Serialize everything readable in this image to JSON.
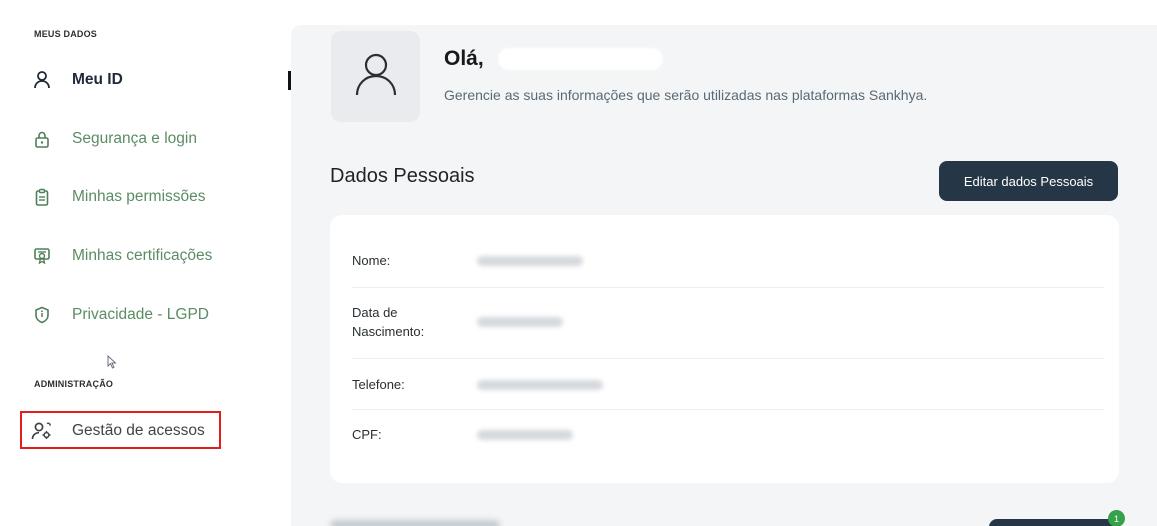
{
  "sidebar": {
    "section_my_data": "MEUS DADOS",
    "items": [
      {
        "label": "Meu ID",
        "icon": "user-icon"
      },
      {
        "label": "Segurança e login",
        "icon": "lock-icon"
      },
      {
        "label": "Minhas permissões",
        "icon": "clipboard-icon"
      },
      {
        "label": "Minhas certificações",
        "icon": "certificate-icon"
      },
      {
        "label": "Privacidade - LGPD",
        "icon": "shield-icon"
      }
    ],
    "section_admin": "ADMINISTRAÇÃO",
    "admin_items": [
      {
        "label": "Gestão de acessos",
        "icon": "user-settings-icon"
      }
    ]
  },
  "header": {
    "greeting": "Olá,",
    "subtitle": "Gerencie as suas informações que serão utilizadas nas plataformas Sankhya."
  },
  "personal_data": {
    "title": "Dados Pessoais",
    "edit_button": "Editar dados Pessoais",
    "fields": [
      {
        "label": "Nome:"
      },
      {
        "label": "Data de Nascimento:"
      },
      {
        "label": "Telefone:"
      },
      {
        "label": "CPF:"
      }
    ]
  },
  "badge_count": "1",
  "colors": {
    "accent_green": "#5b8c64",
    "button_dark": "#253646",
    "highlight_red": "#e11d1d",
    "badge_green": "#37a14a"
  }
}
